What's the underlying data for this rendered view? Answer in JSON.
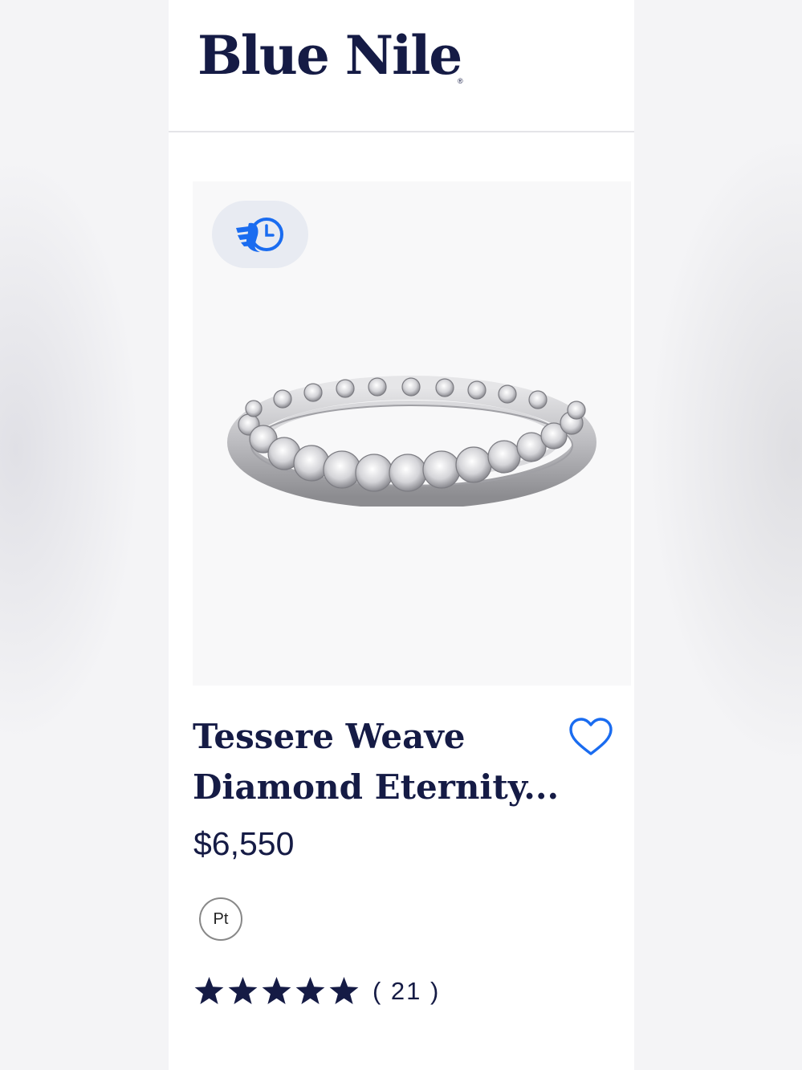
{
  "brand": {
    "logo_text": "Blue Nile",
    "registered_mark": "®",
    "primary_color": "#151b45",
    "accent_color": "#1a6cf0"
  },
  "product": {
    "badge_icon": "fast-shipping-icon",
    "image_icon": "eternity-ring-image",
    "title_line1": "Tessere Weave",
    "title_line2": "Diamond Eternity...",
    "price": "$6,550",
    "metal_option": "Pt",
    "rating": {
      "stars": 5,
      "count_text": "( 21 )"
    },
    "favorite_icon": "heart-outline-icon"
  }
}
